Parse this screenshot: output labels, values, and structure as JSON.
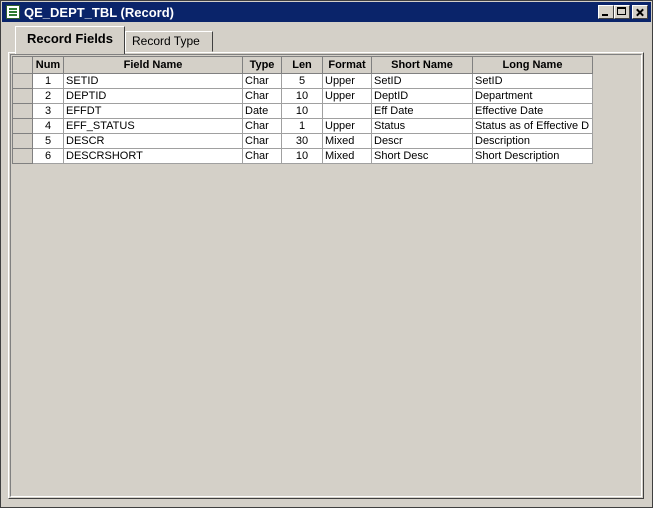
{
  "window": {
    "title": "QE_DEPT_TBL (Record)"
  },
  "tabs": [
    {
      "label": "Record Fields",
      "active": true
    },
    {
      "label": "Record Type",
      "active": false
    }
  ],
  "grid": {
    "headers": [
      "Num",
      "Field Name",
      "Type",
      "Len",
      "Format",
      "Short Name",
      "Long Name"
    ],
    "rows": [
      [
        "1",
        "SETID",
        "Char",
        "5",
        "Upper",
        "SetID",
        "SetID"
      ],
      [
        "2",
        "DEPTID",
        "Char",
        "10",
        "Upper",
        "DeptID",
        "Department"
      ],
      [
        "3",
        "EFFDT",
        "Date",
        "10",
        "",
        "Eff Date",
        "Effective Date"
      ],
      [
        "4",
        "EFF_STATUS",
        "Char",
        "1",
        "Upper",
        "Status",
        "Status as of Effective D"
      ],
      [
        "5",
        "DESCR",
        "Char",
        "30",
        "Mixed",
        "Descr",
        "Description"
      ],
      [
        "6",
        "DESCRSHORT",
        "Char",
        "10",
        "Mixed",
        "Short Desc",
        "Short Description"
      ]
    ]
  }
}
